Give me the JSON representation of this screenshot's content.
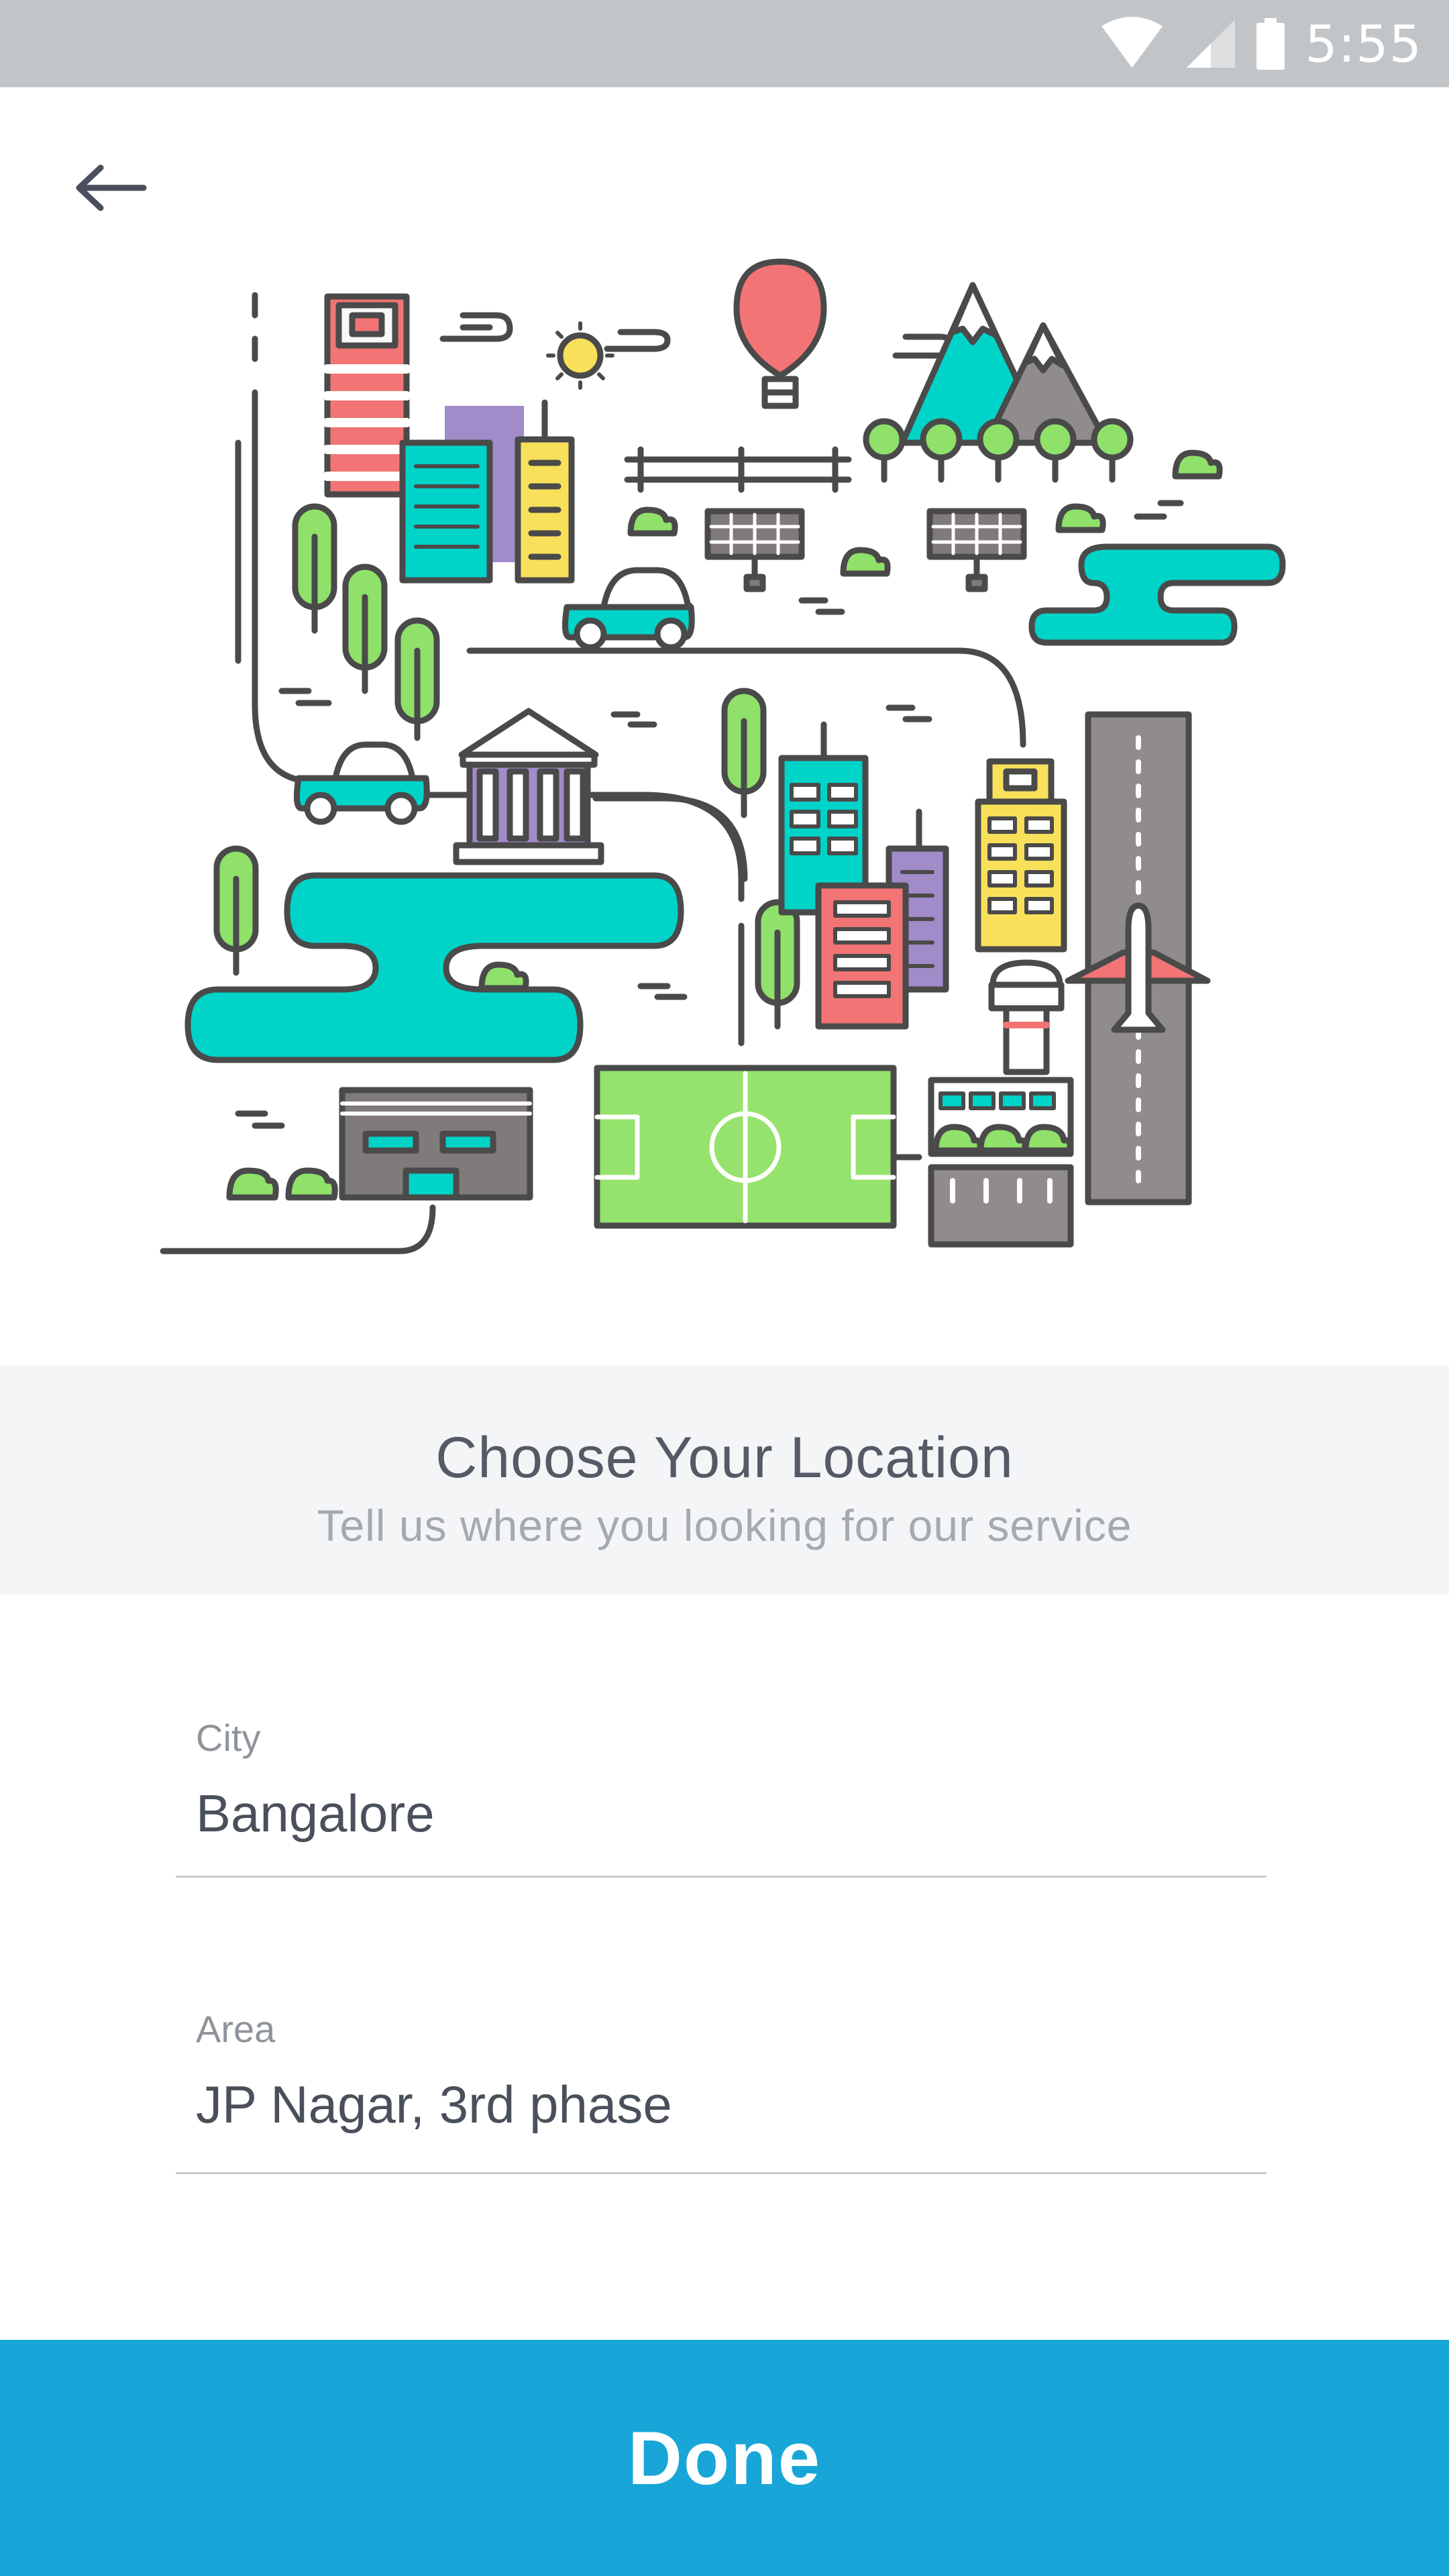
{
  "status_bar": {
    "time": "5:55",
    "icons": [
      "wifi-icon",
      "signal-icon",
      "battery-icon"
    ]
  },
  "nav": {
    "back_icon": "arrow-left-icon"
  },
  "illustration": {
    "name": "city-map-illustration"
  },
  "heading": {
    "title": "Choose Your Location",
    "subtitle": "Tell us where you looking for our service"
  },
  "form": {
    "city": {
      "label": "City",
      "value": "Bangalore"
    },
    "area": {
      "label": "Area",
      "value": "JP Nagar, 3rd phase"
    }
  },
  "done_button": {
    "label": "Done"
  },
  "colors": {
    "status_bar": "#c2c5c8",
    "accent": "#18a5d8",
    "turquoise": "#00d3c8",
    "coral": "#f27474",
    "yellow": "#f8e05a",
    "green": "#8fe16a",
    "purple": "#9d87c4",
    "gray": "#918c8c"
  }
}
